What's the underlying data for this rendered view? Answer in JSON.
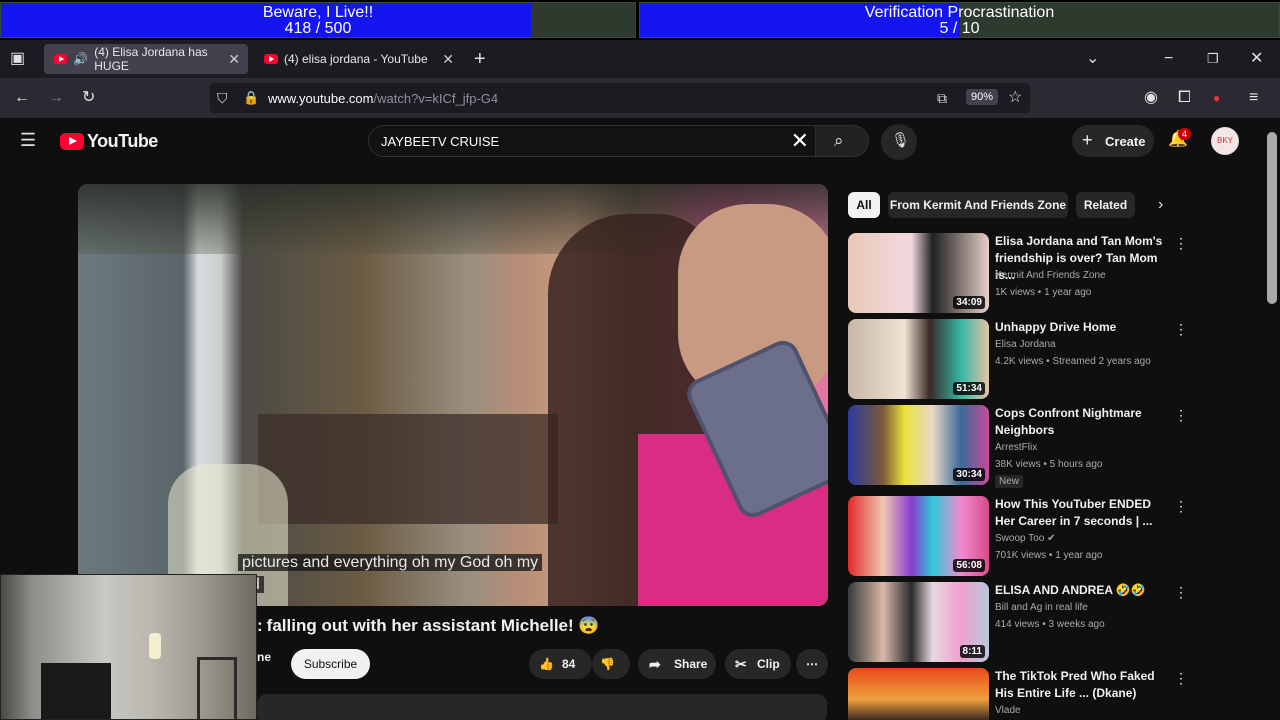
{
  "overlay": {
    "goal1": {
      "title": "Beware, I Live!!",
      "count": "418 / 500",
      "progress": 0.836
    },
    "goal2": {
      "title": "Verification Procrastination",
      "count": "5 / 10",
      "progress": 0.5
    }
  },
  "browser": {
    "tabs": [
      {
        "label": "(4) Elisa Jordana has HUGE",
        "active": true
      },
      {
        "label": "(4) elisa jordana - YouTube",
        "active": false
      }
    ],
    "url_host": "www.youtube.com",
    "url_path": "/watch?v=kICf_jfp-G4",
    "zoom": "90%"
  },
  "youtube": {
    "logo_text": "YouTube",
    "search_value": "JAYBEETV CRUISE",
    "create_label": "Create",
    "notif_count": "4",
    "avatar_text": "BKY"
  },
  "player": {
    "caption_line1": "pictures and everything oh my God oh my",
    "caption_line2": "od"
  },
  "video": {
    "title": "falling out with her assistant Michelle! 😨",
    "channel_fragment": "ne",
    "subscribe_label": "Subscribe",
    "likes": "84",
    "share_label": "Share",
    "clip_label": "Clip"
  },
  "chips": [
    "All",
    "From Kermit And Friends Zone",
    "Related"
  ],
  "recommendations": [
    {
      "title": "Elisa Jordana and Tan Mom's friendship is over? Tan Mom is...",
      "channel": "Kermit And Friends Zone",
      "meta": "1K views • 1 year ago",
      "duration": "34:09",
      "badge": ""
    },
    {
      "title": "Unhappy Drive Home",
      "channel": "Elisa Jordana",
      "meta": "4.2K views • Streamed 2 years ago",
      "duration": "51:34",
      "badge": ""
    },
    {
      "title": "Cops Confront Nightmare Neighbors",
      "channel": "ArrestFlix",
      "meta": "38K views • 5 hours ago",
      "duration": "30:34",
      "badge": "New"
    },
    {
      "title": "How This YouTuber ENDED Her Career in 7 seconds | ...",
      "channel": "Swoop Too ✔",
      "meta": "701K views • 1 year ago",
      "duration": "56:08",
      "badge": ""
    },
    {
      "title": "ELISA AND ANDREA 🤣🤣",
      "channel": "Bill and Ag in real life",
      "meta": "414 views • 3 weeks ago",
      "duration": "8:11",
      "badge": ""
    },
    {
      "title": "The TikTok Pred Who Faked His Entire Life ... (Dkane)",
      "channel": "Vlade",
      "meta": "",
      "duration": "",
      "badge": ""
    }
  ],
  "colors": {
    "goal_fill": "#1515f0",
    "youtube_red": "#ff0033",
    "page_bg": "#0f0f0f"
  }
}
